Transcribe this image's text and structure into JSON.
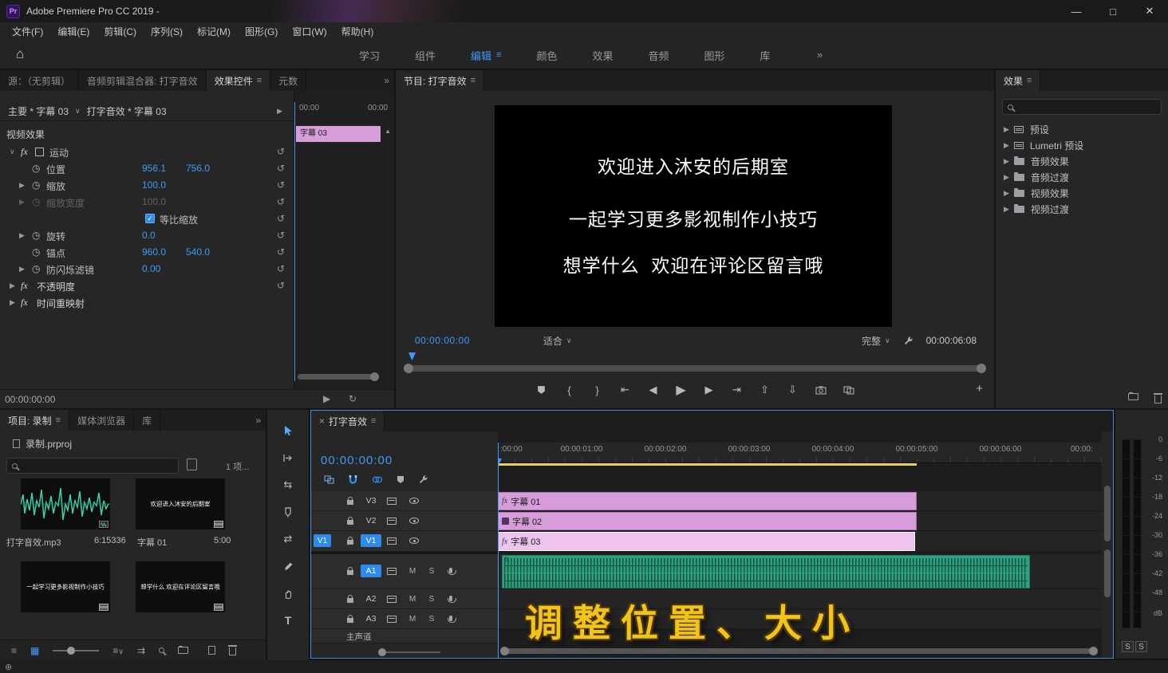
{
  "colors": {
    "accent_blue": "#2d8ceb",
    "value_blue": "#3f9bfa",
    "clip_pink": "#d79ddb",
    "clip_pink_selected": "#eec3f0",
    "audio_green": "#2ea182",
    "overlay_yellow": "#f2c318"
  },
  "title_bar": {
    "app_icon_label": "Pr",
    "title": "Adobe Premiere Pro CC 2019 -"
  },
  "menu": {
    "items": [
      "文件(F)",
      "编辑(E)",
      "剪辑(C)",
      "序列(S)",
      "标记(M)",
      "图形(G)",
      "窗口(W)",
      "帮助(H)"
    ]
  },
  "workspace": {
    "tabs": [
      {
        "label": "学习"
      },
      {
        "label": "组件"
      },
      {
        "label": "编辑",
        "active": true
      },
      {
        "label": "颜色"
      },
      {
        "label": "效果"
      },
      {
        "label": "音频"
      },
      {
        "label": "图形"
      },
      {
        "label": "库"
      }
    ],
    "overflow": "»"
  },
  "effect_controls": {
    "tabs": [
      {
        "label": "源：（无剪辑）"
      },
      {
        "label": "音频剪辑混合器: 打字音效"
      },
      {
        "label": "效果控件",
        "active": true
      },
      {
        "label": "元数"
      }
    ],
    "overflow": "»",
    "master_clip": "主要 * 字幕 03",
    "sequence_clip": "打字音效 * 字幕 03",
    "ruler_labels": [
      "00:00",
      "00:00"
    ],
    "mini_clip_label": "字幕 03",
    "section_label": "视频效果",
    "rows": {
      "motion": {
        "label": "运动"
      },
      "position": {
        "label": "位置",
        "v1": "956.1",
        "v2": "756.0"
      },
      "scale": {
        "label": "缩放",
        "v1": "100.0"
      },
      "scale_width": {
        "label": "缩放宽度",
        "v1": "100.0"
      },
      "uniform_scale": {
        "label": "等比缩放"
      },
      "rotation": {
        "label": "旋转",
        "v1": "0.0"
      },
      "anchor": {
        "label": "锚点",
        "v1": "960.0",
        "v2": "540.0"
      },
      "anti_flicker": {
        "label": "防闪烁滤镜",
        "v1": "0.00"
      },
      "opacity": {
        "label": "不透明度"
      },
      "time_remap": {
        "label": "时间重映射"
      }
    },
    "timecode": "00:00:00:00"
  },
  "program": {
    "tab_label": "节目: 打字音效",
    "preview_lines": [
      "欢迎进入沐安的后期室",
      "一起学习更多影视制作小技巧",
      "想学什么  欢迎在评论区留言哦"
    ],
    "current_time": "00:00:00:00",
    "fit_select": "适合",
    "quality_select": "完整",
    "duration": "00:00:06:08"
  },
  "effects_panel": {
    "tab_label": "效果",
    "items": [
      {
        "label": "预设"
      },
      {
        "label": "Lumetri 预设"
      },
      {
        "label": "音频效果"
      },
      {
        "label": "音频过渡"
      },
      {
        "label": "视频效果"
      },
      {
        "label": "视频过渡"
      }
    ]
  },
  "project_panel": {
    "tabs": [
      {
        "label": "项目: 录制",
        "active": true
      },
      {
        "label": "媒体浏览器"
      },
      {
        "label": "库"
      }
    ],
    "overflow": "»",
    "project_file": "录制.prproj",
    "item_count": "1 项...",
    "items": [
      {
        "name": "打字音效.mp3",
        "duration": "6:15336",
        "kind": "audio"
      },
      {
        "name": "字幕 01",
        "duration": "5:00",
        "kind": "title",
        "thumb_text": "欢迎进入沐安的后期室"
      },
      {
        "name": "",
        "duration": "",
        "kind": "title",
        "thumb_text": "一起学习更多影视制作小技巧"
      },
      {
        "name": "",
        "duration": "",
        "kind": "title",
        "thumb_text": "想学什么 欢迎在评论区留言哦"
      }
    ]
  },
  "timeline": {
    "tab_label": "打字音效",
    "timecode": "00:00:00:00",
    "ruler_labels": [
      ":00:00",
      "00:00:01:00",
      "00:00:02:00",
      "00:00:03:00",
      "00:00:04:00",
      "00:00:05:00",
      "00:00:06:00",
      "00:00:"
    ],
    "video_tracks": [
      {
        "name": "V3",
        "clip": "字幕 01"
      },
      {
        "name": "V2",
        "clip": "字幕 02"
      },
      {
        "name": "V1",
        "clip": "字幕 03",
        "selected": true,
        "source_badge": "V1"
      }
    ],
    "audio_tracks": [
      {
        "name": "A1"
      },
      {
        "name": "A2"
      },
      {
        "name": "A3"
      }
    ],
    "master_track": "主声道",
    "mute_label": "M",
    "solo_label": "S",
    "overlay_text": "调整位置、大小"
  },
  "meters": {
    "scale": [
      "0",
      "-6",
      "-12",
      "-18",
      "-24",
      "-30",
      "-36",
      "-42",
      "-48",
      "dB"
    ],
    "solo_left": "S",
    "solo_right": "S"
  }
}
